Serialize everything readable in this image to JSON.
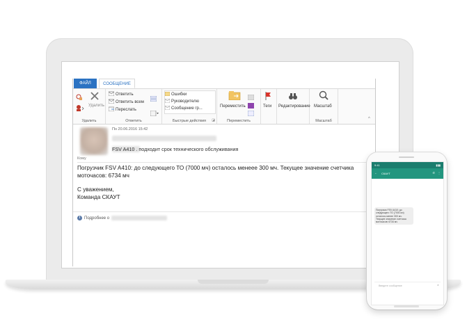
{
  "outlook": {
    "tabs": {
      "file": "ФАЙЛ",
      "message": "СООБЩЕНИЕ"
    },
    "ribbon": {
      "delete": {
        "label": "Удалить",
        "group": "Удалить"
      },
      "respond": {
        "reply": "Ответить",
        "reply_all": "Ответить всем",
        "forward": "Переслать",
        "group": "Ответить"
      },
      "quick_steps": {
        "items": [
          "Ошибки",
          "Руководителю",
          "Сообщение гр..."
        ],
        "group": "Быстрые действия"
      },
      "move": {
        "label": "Переместить",
        "group": "Переместить"
      },
      "tags": {
        "label": "Теги"
      },
      "editing": {
        "label": "Редактирование"
      },
      "zoom": {
        "label": "Масштаб",
        "group": "Масштаб"
      }
    },
    "message": {
      "datetime": "Пн 20.06.2016 15:42",
      "subject": "FSV A410 . подходит срок технического обслуживания",
      "to_label": "Кому",
      "body_line1": "Погрузчик FSV A410: до следующего ТО (7000 мч) осталось менеее 300 мч. Текущее значение счетчика",
      "body_line2": "моточасов: 6734 мч",
      "sign_line1": "С уважением,",
      "sign_line2": "Команда СКАУТ",
      "info_prefix": "Подробнее о"
    }
  },
  "phone": {
    "status_time": "9:41",
    "contact": "СКАУТ",
    "sms_text": "Погрузчик FSV A410: до следующего ТО (7000 мч) осталось менее 300 мч. Текущее значение счетчика моточасов: 6734 мч",
    "input_placeholder": "Введите сообщение"
  },
  "colors": {
    "file_tab": "#2b72c2",
    "phone_header": "#23967f"
  },
  "icons": [
    "delete-icon",
    "reply-icon",
    "reply-all-icon",
    "forward-icon",
    "folder-move-icon",
    "flag-icon",
    "binoculars-icon",
    "magnifier-icon",
    "info-icon"
  ]
}
